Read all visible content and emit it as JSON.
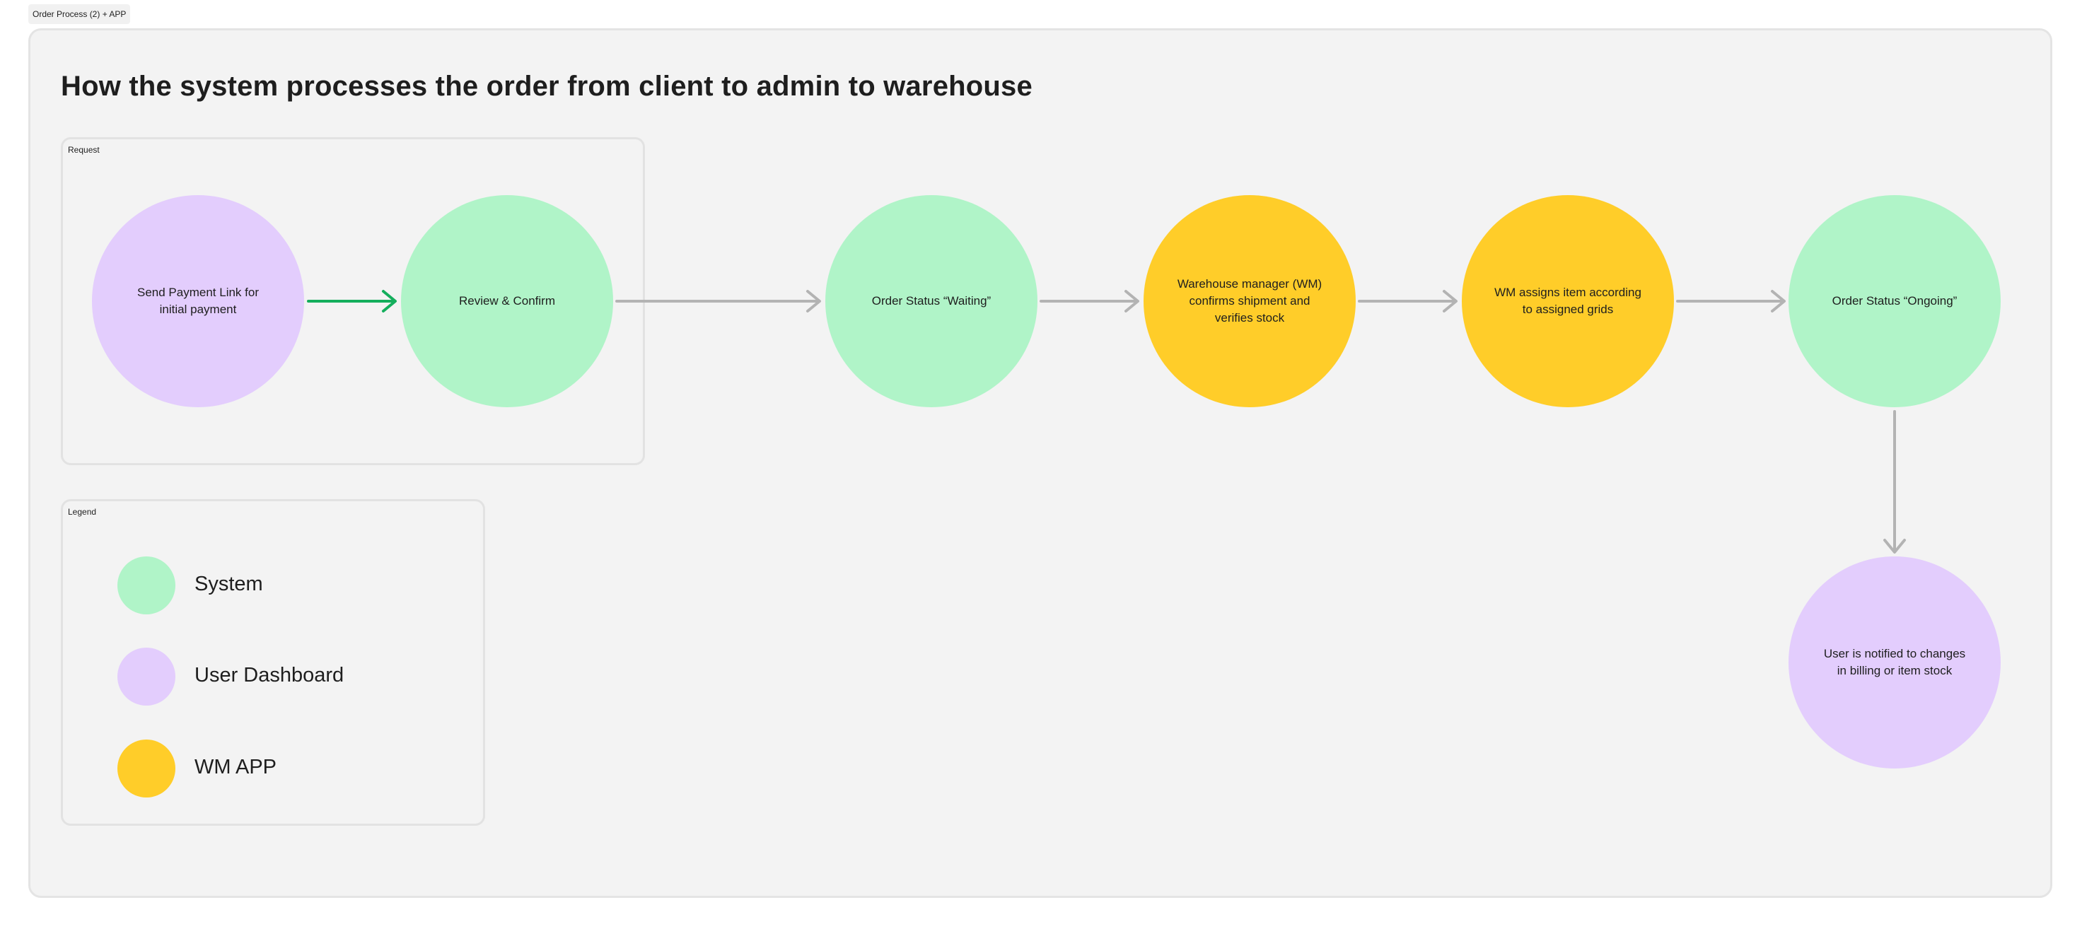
{
  "frame": {
    "name": "Order Process (2) + APP"
  },
  "title": "How the system processes the order from client to admin to warehouse",
  "sections": {
    "request": "Request",
    "legend": "Legend"
  },
  "nodes": {
    "send_payment": "Send Payment Link for initial payment",
    "review_confirm": "Review & Confirm",
    "status_waiting": "Order Status “Waiting”",
    "wm_confirms": "Warehouse manager (WM) confirms shipment and verifies stock",
    "wm_assigns": "WM assigns item according to assigned grids",
    "status_ongoing": "Order Status “Ongoing”",
    "user_notified": "User is notified to changes in billing or item stock"
  },
  "legend": {
    "system": "System",
    "user_dashboard": "User Dashboard",
    "wm_app": "WM APP"
  },
  "colors": {
    "system": "#b0f4c8",
    "user_dashboard": "#e3cdfd",
    "wm_app": "#ffcd29",
    "connector_green": "#14ae5c",
    "connector_gray": "#b3b3b3"
  }
}
